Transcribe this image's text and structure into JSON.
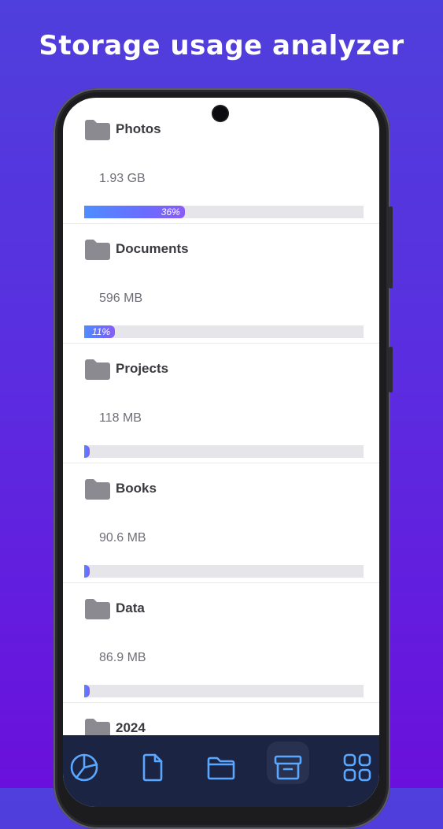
{
  "header": {
    "title": "Storage usage analyzer"
  },
  "folders": [
    {
      "name": "Photos",
      "size": "1.93 GB",
      "percent": 36,
      "percent_label": "36%"
    },
    {
      "name": "Documents",
      "size": "596 MB",
      "percent": 11,
      "percent_label": "11%"
    },
    {
      "name": "Projects",
      "size": "118 MB",
      "percent": 2,
      "percent_label": ""
    },
    {
      "name": "Books",
      "size": "90.6 MB",
      "percent": 2,
      "percent_label": ""
    },
    {
      "name": "Data",
      "size": "86.9 MB",
      "percent": 2,
      "percent_label": ""
    },
    {
      "name": "2024",
      "size": "",
      "percent": 0,
      "percent_label": ""
    }
  ],
  "nav": {
    "items": [
      {
        "icon": "pie-chart-icon",
        "active": false
      },
      {
        "icon": "file-icon",
        "active": false
      },
      {
        "icon": "folder-icon",
        "active": false
      },
      {
        "icon": "archive-icon",
        "active": true
      },
      {
        "icon": "grid-icon",
        "active": false
      }
    ]
  },
  "colors": {
    "accent": "#5aa7ff",
    "bar_start": "#4f8dff",
    "bar_end": "#8a5cf6",
    "nav_bg": "#1c2443"
  }
}
